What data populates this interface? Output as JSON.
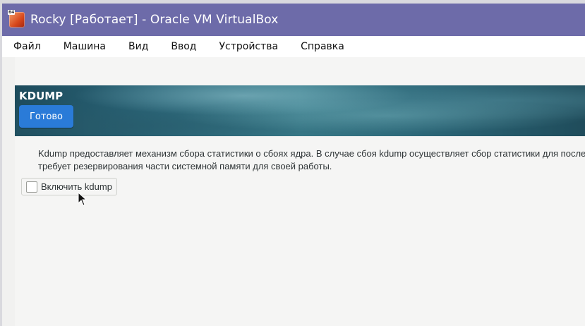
{
  "window": {
    "title": "Rocky [Работает] - Oracle VM VirtualBox",
    "icon": "virtualbox-app-icon",
    "icon_badge": "64",
    "titlebar_color": "#6d6ba9"
  },
  "menubar": {
    "items": [
      {
        "label": "Файл"
      },
      {
        "label": "Машина"
      },
      {
        "label": "Вид"
      },
      {
        "label": "Ввод"
      },
      {
        "label": "Устройства"
      },
      {
        "label": "Справка"
      }
    ]
  },
  "spoke": {
    "title": "KDUMP",
    "done_label": "Готово",
    "done_color": "#2a7bd8",
    "description_line1": "Kdump предоставляет механизм сбора статистики о сбоях ядра. В случае сбоя kdump осуществляет сбор статистики для послед",
    "description_line2": "требует резервирования части системной памяти для своей работы.",
    "enable_label": "Включить kdump",
    "enable_checked": false
  }
}
